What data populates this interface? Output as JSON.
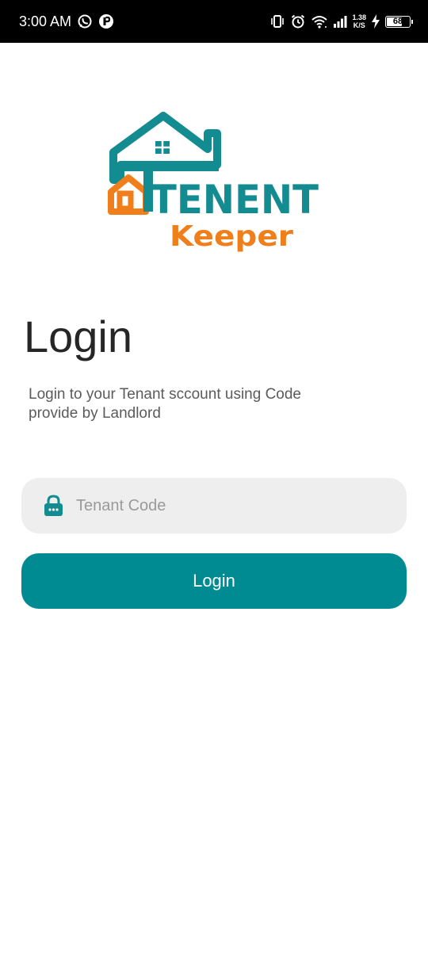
{
  "status_bar": {
    "time": "3:00 AM",
    "net_speed_value": "1.38",
    "net_speed_unit": "K/S",
    "battery_level": "68",
    "battery_fraction": 0.68
  },
  "logo": {
    "word_main": "TENENT",
    "word_sub": "Keeper",
    "colors": {
      "teal": "#138c91",
      "orange": "#f07f1b"
    }
  },
  "page": {
    "title": "Login",
    "subtitle": "Login to your Tenant sccount using Code provide by Landlord"
  },
  "form": {
    "code_placeholder": "Tenant Code",
    "code_value": "",
    "submit_label": "Login"
  },
  "colors": {
    "accent": "#008b93",
    "field_bg": "#eeeeee",
    "status_bar_bg": "#000000"
  },
  "icons": [
    "whatsapp-icon",
    "app-notification-icon",
    "vibrate-icon",
    "alarm-icon",
    "wifi-icon",
    "signal-icon",
    "charging-icon",
    "battery-icon",
    "lock-icon"
  ]
}
